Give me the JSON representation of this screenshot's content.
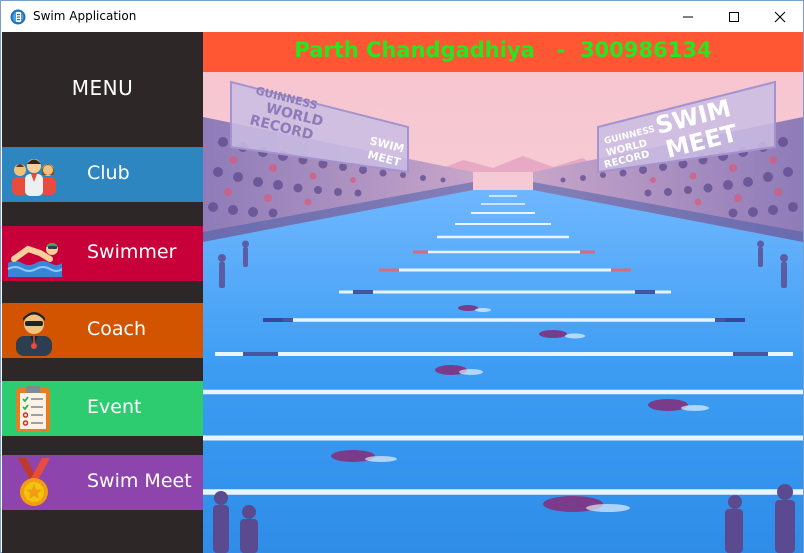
{
  "window": {
    "title": "Swim Application",
    "controls": {
      "minimize": "minimize",
      "maximize": "maximize",
      "close": "close"
    }
  },
  "sidebar": {
    "menu_title": "MENU",
    "items": [
      {
        "label": "Club",
        "color": "#2e86c1",
        "icon": "club-group-icon"
      },
      {
        "label": "Swimmer",
        "color": "#c70039",
        "icon": "swimmer-icon"
      },
      {
        "label": "Coach",
        "color": "#d35400",
        "icon": "coach-icon"
      },
      {
        "label": "Event",
        "color": "#2ecc71",
        "icon": "clipboard-icon"
      },
      {
        "label": "Swim Meet",
        "color": "#8e44ad",
        "icon": "medal-icon"
      }
    ]
  },
  "header": {
    "text": "Parth Chandgadhiya   -  300986134",
    "background": "#ff5733",
    "text_color": "#22e81e"
  },
  "scene": {
    "left_sign": {
      "line1": "GUINNESS",
      "line2": "WORLD",
      "line3": "RECORD",
      "line4": "SWIM",
      "line5": "MEET"
    },
    "right_sign": {
      "line1": "GUINNESS",
      "line2": "WORLD",
      "line3": "RECORD",
      "line4": "SWIM",
      "line5": "MEET"
    }
  }
}
